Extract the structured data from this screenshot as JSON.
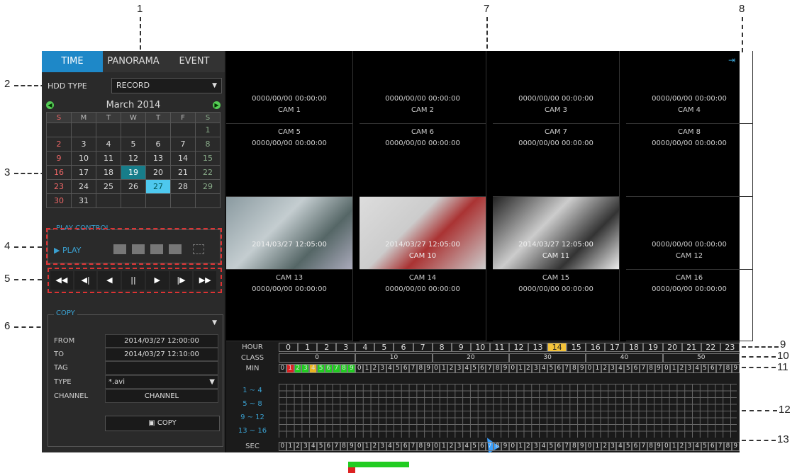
{
  "callouts": [
    "1",
    "2",
    "3",
    "4",
    "5",
    "6",
    "7",
    "8",
    "9",
    "10",
    "11",
    "12",
    "13"
  ],
  "tabs": [
    "TIME",
    "PANORAMA",
    "EVENT"
  ],
  "hdd": {
    "label": "HDD TYPE",
    "value": "RECORD"
  },
  "calendar": {
    "title": "March  2014",
    "dow": [
      "S",
      "M",
      "T",
      "W",
      "T",
      "F",
      "S"
    ],
    "weeks": [
      [
        "",
        "",
        "",
        "",
        "",
        "",
        "1"
      ],
      [
        "2",
        "3",
        "4",
        "5",
        "6",
        "7",
        "8"
      ],
      [
        "9",
        "10",
        "11",
        "12",
        "13",
        "14",
        "15"
      ],
      [
        "16",
        "17",
        "18",
        "19",
        "20",
        "21",
        "22"
      ],
      [
        "23",
        "24",
        "25",
        "26",
        "27",
        "28",
        "29"
      ],
      [
        "30",
        "31",
        "",
        "",
        "",
        "",
        ""
      ]
    ]
  },
  "play": {
    "title": "PLAY CONTROL",
    "label": "PLAY"
  },
  "controls": [
    "◀◀",
    "◀|",
    "◀",
    "||",
    "▶",
    "|▶",
    "▶▶"
  ],
  "copy": {
    "title": "COPY",
    "from_label": "FROM",
    "from": "2014/03/27 12:00:00",
    "to_label": "TO",
    "to": "2014/03/27 12:10:00",
    "tag_label": "TAG",
    "tag": "",
    "type_label": "TYPE",
    "type": "*.avi",
    "channel_label": "CHANNEL",
    "channel": "CHANNEL",
    "button": "COPY"
  },
  "cams": [
    {
      "name": "CAM 1",
      "time": "0000/00/00 00:00:00"
    },
    {
      "name": "CAM 2",
      "time": "0000/00/00 00:00:00"
    },
    {
      "name": "CAM 3",
      "time": "0000/00/00 00:00:00"
    },
    {
      "name": "CAM 4",
      "time": "0000/00/00 00:00:00"
    },
    {
      "name": "CAM 5",
      "time": "0000/00/00 00:00:00"
    },
    {
      "name": "CAM 6",
      "time": "0000/00/00 00:00:00"
    },
    {
      "name": "CAM 7",
      "time": "0000/00/00 00:00:00"
    },
    {
      "name": "CAM 8",
      "time": "0000/00/00 00:00:00"
    },
    {
      "name": "",
      "time": "2014/03/27 12:05:00"
    },
    {
      "name": "CAM 10",
      "time": "2014/03/27 12:05:00"
    },
    {
      "name": "CAM 11",
      "time": "2014/03/27 12:05:00"
    },
    {
      "name": "CAM 12",
      "time": "0000/00/00 00:00:00"
    },
    {
      "name": "CAM 13",
      "time": "0000/00/00 00:00:00"
    },
    {
      "name": "CAM 14",
      "time": "0000/00/00 00:00:00"
    },
    {
      "name": "CAM 15",
      "time": "0000/00/00 00:00:00"
    },
    {
      "name": "CAM 16",
      "time": "0000/00/00 00:00:00"
    }
  ],
  "timeline": {
    "hour_label": "HOUR",
    "hours": [
      "0",
      "1",
      "2",
      "3",
      "4",
      "5",
      "6",
      "7",
      "8",
      "9",
      "10",
      "11",
      "12",
      "13",
      "14",
      "15",
      "16",
      "17",
      "18",
      "19",
      "20",
      "21",
      "22",
      "23"
    ],
    "class_label": "CLASS",
    "classes": [
      "0",
      "10",
      "20",
      "30",
      "40",
      "50"
    ],
    "min_label": "MIN",
    "sec_label": "SEC",
    "channel_groups": [
      "1 ~ 4",
      "5 ~ 8",
      "9 ~ 12",
      "13 ~ 16"
    ]
  }
}
